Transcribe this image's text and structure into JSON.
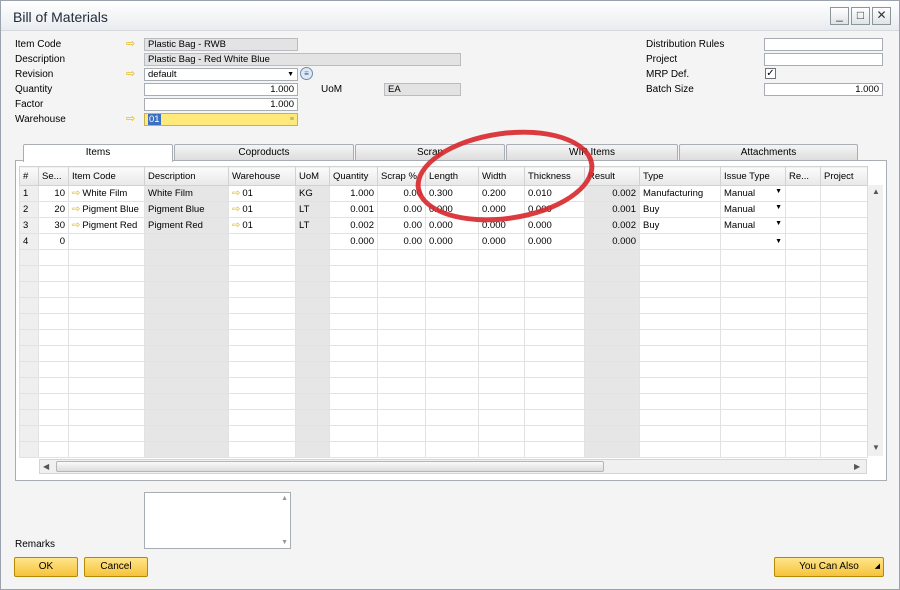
{
  "window": {
    "title": "Bill of Materials",
    "controls": [
      "_",
      "□",
      "✕"
    ]
  },
  "header": {
    "item_code_label": "Item Code",
    "item_code_value": "Plastic Bag - RWB",
    "description_label": "Description",
    "description_value": "Plastic Bag - Red White Blue",
    "revision_label": "Revision",
    "revision_value": "default",
    "quantity_label": "Quantity",
    "quantity_value": "1.000",
    "uom_label": "UoM",
    "uom_value": "EA",
    "factor_label": "Factor",
    "factor_value": "1.000",
    "warehouse_label": "Warehouse",
    "warehouse_value": "01",
    "distribution_rules_label": "Distribution Rules",
    "distribution_rules_value": "",
    "project_label": "Project",
    "project_value": "",
    "mrp_def_label": "MRP Def.",
    "mrp_def_checked": "✓",
    "batch_size_label": "Batch Size",
    "batch_size_value": "1.000"
  },
  "tabs": [
    "Items",
    "Coproducts",
    "Scrap",
    "WIP Items",
    "Attachments"
  ],
  "grid": {
    "columns": [
      "#",
      "Se...",
      "Item Code",
      "Description",
      "Warehouse",
      "UoM",
      "Quantity",
      "Scrap %",
      "Length",
      "Width",
      "Thickness",
      "Result",
      "Type",
      "Issue Type",
      "Re...",
      "Project"
    ],
    "rows": [
      [
        "1",
        "10",
        "White Film",
        "White Film",
        "01",
        "KG",
        "1.000",
        "0.00",
        "0.300",
        "0.200",
        "0.010",
        "0.002",
        "Manufacturing",
        "Manual",
        "",
        ""
      ],
      [
        "2",
        "20",
        "Pigment Blue",
        "Pigment Blue",
        "01",
        "LT",
        "0.001",
        "0.00",
        "0.000",
        "0.000",
        "0.000",
        "0.001",
        "Buy",
        "Manual",
        "",
        ""
      ],
      [
        "3",
        "30",
        "Pigment Red",
        "Pigment Red",
        "01",
        "LT",
        "0.002",
        "0.00",
        "0.000",
        "0.000",
        "0.000",
        "0.002",
        "Buy",
        "Manual",
        "",
        ""
      ],
      [
        "4",
        "0",
        "",
        "",
        "",
        "",
        "0.000",
        "0.00",
        "0.000",
        "0.000",
        "0.000",
        "0.000",
        "",
        "",
        "",
        ""
      ]
    ]
  },
  "footer": {
    "remarks_label": "Remarks",
    "ok_label": "OK",
    "cancel_label": "Cancel",
    "you_can_also_label": "You Can Also"
  },
  "colors": {
    "accent_button": "#f5c33c",
    "highlight_circle": "#d8262a",
    "link_arrow": "#e8b400"
  }
}
